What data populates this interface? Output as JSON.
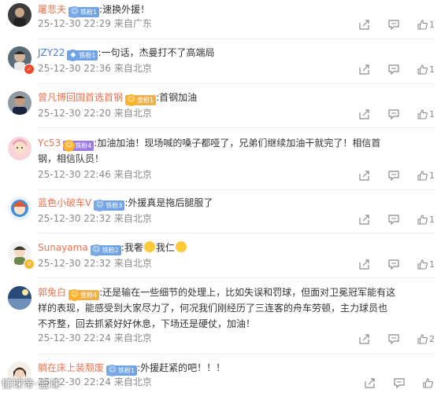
{
  "comments": [
    {
      "user": "屠悲夫",
      "badge": "铁粉1",
      "text": ":速换外援！",
      "time": "25-12-30 22:29",
      "source": "来自广东",
      "likes": "1"
    },
    {
      "user": "JZY22",
      "badge": "铁粉1",
      "text": ":一句话，杰曼打不了高端局",
      "time": "25-12-30 22:36",
      "source": "来自北京",
      "likes": "1"
    },
    {
      "user": "曾凡博回国首选首钢",
      "badge": "金粉1",
      "text": ":首钢加油",
      "time": "25-12-30 22:20",
      "source": "来自北京",
      "likes": "1"
    },
    {
      "user": "Yc53",
      "badge": "铁粉4",
      "text": ":加油加油！现场喊的嗓子都哑了，兄弟们继续加油干就完了！相信首钢，相信队员！",
      "time": "25-12-30 22:46",
      "source": "来自北京",
      "likes": "1"
    },
    {
      "user": "蓝色小破车V",
      "badge": "铁粉3",
      "text": ":外援真是拖后腿服了",
      "time": "25-12-30 22:32",
      "source": "来自北京",
      "likes": "1"
    },
    {
      "user": "Sunayama",
      "badge": "铁粉2",
      "text": ":我奢",
      "text_b": "我仁",
      "time": "25-12-30 22:32",
      "source": "来自北京",
      "likes": "1"
    },
    {
      "user": "郭兔白",
      "badge": "金粉4",
      "text": ":还是输在一些细节的处理上，比如失误和罚球，但面对卫冕冠军能有这样的表现，能感受到大家尽力了，何况我们刚经历了三连客的舟车劳顿，主力球员也不齐整，回去抓紧好好休息，下场还是硬仗，加油！",
      "time": "25-12-30 22:24",
      "source": "来自北京",
      "likes": "2"
    },
    {
      "user": "躺在床上装颓废",
      "badge": "铁粉1",
      "text": ":外援赶紧的吧！！！",
      "time": "25-12-30 22:24",
      "source": "来自北京",
      "likes": ""
    }
  ],
  "watermark": "懂球帝·篮球",
  "icons": {
    "share": "share-icon",
    "comment": "comment-icon",
    "like": "thumbs-up-icon"
  },
  "colors": {
    "username": "#eb7350",
    "meta": "#8a8a8a",
    "badge": "#ffb12a"
  }
}
